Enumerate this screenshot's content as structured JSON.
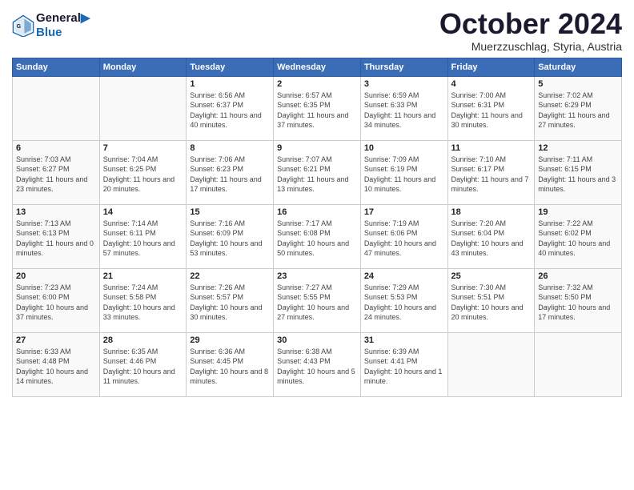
{
  "header": {
    "logo_line1": "General",
    "logo_line2": "Blue",
    "month": "October 2024",
    "location": "Muerzzuschlag, Styria, Austria"
  },
  "weekdays": [
    "Sunday",
    "Monday",
    "Tuesday",
    "Wednesday",
    "Thursday",
    "Friday",
    "Saturday"
  ],
  "weeks": [
    [
      {
        "day": "",
        "info": ""
      },
      {
        "day": "",
        "info": ""
      },
      {
        "day": "1",
        "info": "Sunrise: 6:56 AM\nSunset: 6:37 PM\nDaylight: 11 hours and 40 minutes."
      },
      {
        "day": "2",
        "info": "Sunrise: 6:57 AM\nSunset: 6:35 PM\nDaylight: 11 hours and 37 minutes."
      },
      {
        "day": "3",
        "info": "Sunrise: 6:59 AM\nSunset: 6:33 PM\nDaylight: 11 hours and 34 minutes."
      },
      {
        "day": "4",
        "info": "Sunrise: 7:00 AM\nSunset: 6:31 PM\nDaylight: 11 hours and 30 minutes."
      },
      {
        "day": "5",
        "info": "Sunrise: 7:02 AM\nSunset: 6:29 PM\nDaylight: 11 hours and 27 minutes."
      }
    ],
    [
      {
        "day": "6",
        "info": "Sunrise: 7:03 AM\nSunset: 6:27 PM\nDaylight: 11 hours and 23 minutes."
      },
      {
        "day": "7",
        "info": "Sunrise: 7:04 AM\nSunset: 6:25 PM\nDaylight: 11 hours and 20 minutes."
      },
      {
        "day": "8",
        "info": "Sunrise: 7:06 AM\nSunset: 6:23 PM\nDaylight: 11 hours and 17 minutes."
      },
      {
        "day": "9",
        "info": "Sunrise: 7:07 AM\nSunset: 6:21 PM\nDaylight: 11 hours and 13 minutes."
      },
      {
        "day": "10",
        "info": "Sunrise: 7:09 AM\nSunset: 6:19 PM\nDaylight: 11 hours and 10 minutes."
      },
      {
        "day": "11",
        "info": "Sunrise: 7:10 AM\nSunset: 6:17 PM\nDaylight: 11 hours and 7 minutes."
      },
      {
        "day": "12",
        "info": "Sunrise: 7:11 AM\nSunset: 6:15 PM\nDaylight: 11 hours and 3 minutes."
      }
    ],
    [
      {
        "day": "13",
        "info": "Sunrise: 7:13 AM\nSunset: 6:13 PM\nDaylight: 11 hours and 0 minutes."
      },
      {
        "day": "14",
        "info": "Sunrise: 7:14 AM\nSunset: 6:11 PM\nDaylight: 10 hours and 57 minutes."
      },
      {
        "day": "15",
        "info": "Sunrise: 7:16 AM\nSunset: 6:09 PM\nDaylight: 10 hours and 53 minutes."
      },
      {
        "day": "16",
        "info": "Sunrise: 7:17 AM\nSunset: 6:08 PM\nDaylight: 10 hours and 50 minutes."
      },
      {
        "day": "17",
        "info": "Sunrise: 7:19 AM\nSunset: 6:06 PM\nDaylight: 10 hours and 47 minutes."
      },
      {
        "day": "18",
        "info": "Sunrise: 7:20 AM\nSunset: 6:04 PM\nDaylight: 10 hours and 43 minutes."
      },
      {
        "day": "19",
        "info": "Sunrise: 7:22 AM\nSunset: 6:02 PM\nDaylight: 10 hours and 40 minutes."
      }
    ],
    [
      {
        "day": "20",
        "info": "Sunrise: 7:23 AM\nSunset: 6:00 PM\nDaylight: 10 hours and 37 minutes."
      },
      {
        "day": "21",
        "info": "Sunrise: 7:24 AM\nSunset: 5:58 PM\nDaylight: 10 hours and 33 minutes."
      },
      {
        "day": "22",
        "info": "Sunrise: 7:26 AM\nSunset: 5:57 PM\nDaylight: 10 hours and 30 minutes."
      },
      {
        "day": "23",
        "info": "Sunrise: 7:27 AM\nSunset: 5:55 PM\nDaylight: 10 hours and 27 minutes."
      },
      {
        "day": "24",
        "info": "Sunrise: 7:29 AM\nSunset: 5:53 PM\nDaylight: 10 hours and 24 minutes."
      },
      {
        "day": "25",
        "info": "Sunrise: 7:30 AM\nSunset: 5:51 PM\nDaylight: 10 hours and 20 minutes."
      },
      {
        "day": "26",
        "info": "Sunrise: 7:32 AM\nSunset: 5:50 PM\nDaylight: 10 hours and 17 minutes."
      }
    ],
    [
      {
        "day": "27",
        "info": "Sunrise: 6:33 AM\nSunset: 4:48 PM\nDaylight: 10 hours and 14 minutes."
      },
      {
        "day": "28",
        "info": "Sunrise: 6:35 AM\nSunset: 4:46 PM\nDaylight: 10 hours and 11 minutes."
      },
      {
        "day": "29",
        "info": "Sunrise: 6:36 AM\nSunset: 4:45 PM\nDaylight: 10 hours and 8 minutes."
      },
      {
        "day": "30",
        "info": "Sunrise: 6:38 AM\nSunset: 4:43 PM\nDaylight: 10 hours and 5 minutes."
      },
      {
        "day": "31",
        "info": "Sunrise: 6:39 AM\nSunset: 4:41 PM\nDaylight: 10 hours and 1 minute."
      },
      {
        "day": "",
        "info": ""
      },
      {
        "day": "",
        "info": ""
      }
    ]
  ]
}
